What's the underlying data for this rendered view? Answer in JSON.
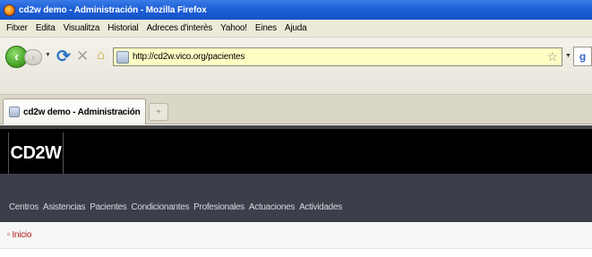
{
  "window": {
    "title": "cd2w demo - Administración - Mozilla Firefox"
  },
  "menu": [
    "Fitxer",
    "Edita",
    "Visualitza",
    "Historial",
    "Adreces d'interès",
    "Yahoo!",
    "Eines",
    "Ajuda"
  ],
  "navigation": {
    "url": "http://cd2w.vico.org/pacientes"
  },
  "tabs": [
    {
      "label": "cd2w demo - Administración"
    }
  ],
  "site": {
    "logo": "CD2W",
    "nav": [
      "Centros",
      "Asistencias",
      "Pacientes",
      "Condicionantes",
      "Profesionales",
      "Actuaciones",
      "Actividades"
    ],
    "breadcrumb": [
      "Inicio"
    ]
  },
  "icons": [
    "firefox-icon",
    "back-icon",
    "forward-icon",
    "reload-icon",
    "stop-icon",
    "home-icon",
    "site-icon",
    "star-icon",
    "search-engine-icon",
    "new-tab-icon",
    "home-crumb-icon"
  ],
  "colors": {
    "titlebar": "#1d5fd6",
    "urlbar": "#ffffc4",
    "header": "#000000",
    "nav": "#3b3f4a",
    "breadcrumb_link": "#b32222"
  }
}
